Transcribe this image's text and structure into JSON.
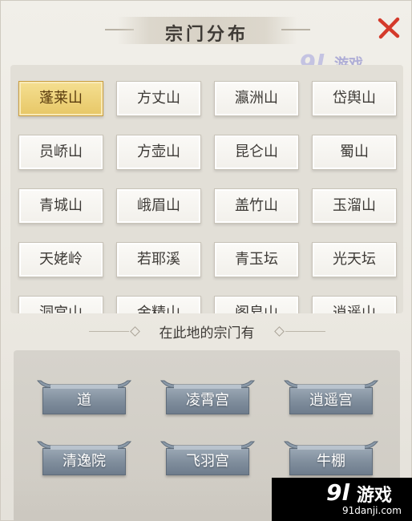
{
  "title": "宗门分布",
  "close_icon": "close-x-icon",
  "accent_close": "#d43a2b",
  "mountains": [
    {
      "label": "蓬莱山",
      "selected": true
    },
    {
      "label": "方丈山",
      "selected": false
    },
    {
      "label": "瀛洲山",
      "selected": false
    },
    {
      "label": "岱舆山",
      "selected": false
    },
    {
      "label": "员峤山",
      "selected": false
    },
    {
      "label": "方壶山",
      "selected": false
    },
    {
      "label": "昆仑山",
      "selected": false
    },
    {
      "label": "蜀山",
      "selected": false
    },
    {
      "label": "青城山",
      "selected": false
    },
    {
      "label": "峨眉山",
      "selected": false
    },
    {
      "label": "盖竹山",
      "selected": false
    },
    {
      "label": "玉溜山",
      "selected": false
    },
    {
      "label": "天姥岭",
      "selected": false
    },
    {
      "label": "若耶溪",
      "selected": false
    },
    {
      "label": "青玉坛",
      "selected": false
    },
    {
      "label": "光天坛",
      "selected": false
    },
    {
      "label": "洞宫山",
      "selected": false
    },
    {
      "label": "金精山",
      "selected": false
    },
    {
      "label": "阁皂山",
      "selected": false
    },
    {
      "label": "逍遥山",
      "selected": false
    }
  ],
  "sects_heading": "在此地的宗门有",
  "sects": [
    {
      "label": "道"
    },
    {
      "label": "凌霄宫"
    },
    {
      "label": "逍遥宫"
    },
    {
      "label": "清逸院"
    },
    {
      "label": "飞羽宫"
    },
    {
      "label": "牛棚"
    }
  ],
  "watermark": {
    "num": "9l",
    "text": "游戏",
    "url": "91danji.com"
  }
}
